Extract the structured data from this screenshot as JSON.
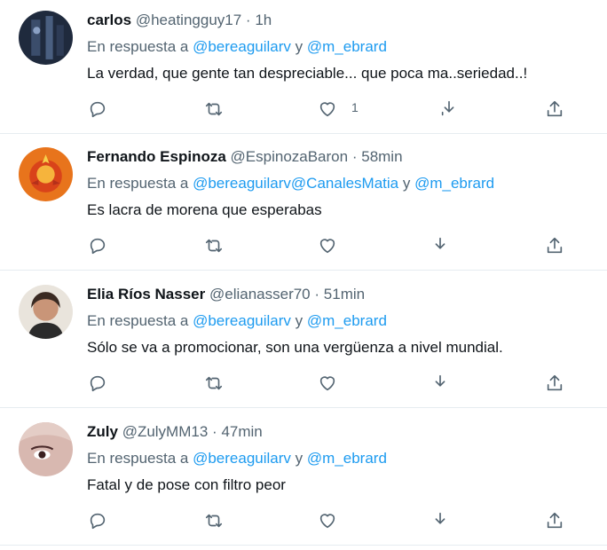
{
  "tweets": [
    {
      "name": "carlos",
      "handle": "@heatingguy17",
      "dot": "·",
      "time": "1h",
      "reply_prefix": "En respuesta a",
      "mentions": [
        "@bereaguilarv",
        "@m_ebrard"
      ],
      "mention_sep": [
        "y"
      ],
      "text": "La verdad, que gente tan despreciable... que poca ma..seriedad..!",
      "likes": "1"
    },
    {
      "name": "Fernando Espinoza",
      "handle": "@EspinozaBaron",
      "dot": "·",
      "time": "58min",
      "reply_prefix": "En respuesta a",
      "mentions": [
        "@bereaguilarv",
        "@CanalesMatia",
        "@m_ebrard"
      ],
      "mention_sep": [
        "",
        "y"
      ],
      "text": "Es lacra de morena que esperabas",
      "likes": ""
    },
    {
      "name": "Elia Ríos Nasser",
      "handle": "@elianasser70",
      "dot": "·",
      "time": "51min",
      "reply_prefix": "En respuesta a",
      "mentions": [
        "@bereaguilarv",
        "@m_ebrard"
      ],
      "mention_sep": [
        "y"
      ],
      "text": "Sólo se va a promocionar, son una vergüenza a nivel mundial.",
      "likes": ""
    },
    {
      "name": "Zuly",
      "handle": "@ZulyMM13",
      "dot": "·",
      "time": "47min",
      "reply_prefix": "En respuesta a",
      "mentions": [
        "@bereaguilarv",
        "@m_ebrard"
      ],
      "mention_sep": [
        "y"
      ],
      "text": "Fatal y de pose con filtro peor",
      "likes": ""
    }
  ],
  "icons": {
    "reply": "reply-icon",
    "retweet": "retweet-icon",
    "like": "heart-icon",
    "download": "download-icon",
    "share": "share-icon"
  },
  "colors": {
    "text": "#0f1419",
    "secondary": "#536471",
    "mention": "#1d9bf0",
    "divider": "#e6ecf0"
  }
}
